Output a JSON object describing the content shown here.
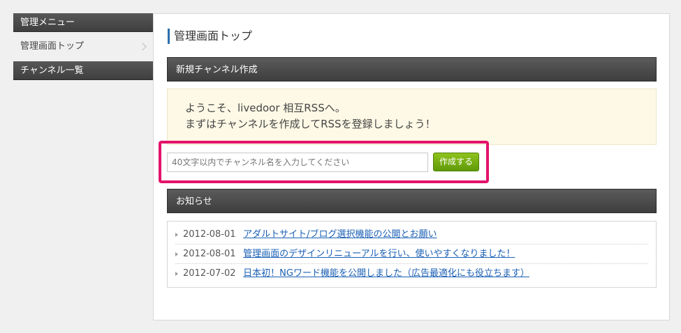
{
  "sidebar": {
    "menu_heading": "管理メニュー",
    "menu_item": "管理画面トップ",
    "channels_heading": "チャンネル一覧"
  },
  "main": {
    "title": "管理画面トップ",
    "new_channel": {
      "heading": "新規チャンネル作成",
      "welcome_line1": "ようこそ、livedoor 相互RSSへ。",
      "welcome_line2": "まずはチャンネルを作成してRSSを登録しましょう！",
      "input_placeholder": "40文字以内でチャンネル名を入力してください",
      "input_value": "",
      "submit_label": "作成する"
    },
    "news": {
      "heading": "お知らせ",
      "items": [
        {
          "date": "2012-08-01",
          "text": "アダルトサイト/ブログ選択機能の公開とお願い"
        },
        {
          "date": "2012-08-01",
          "text": "管理画面のデザインリニューアルを行い、使いやすくなりました！"
        },
        {
          "date": "2012-07-02",
          "text": "日本初！NGワード機能を公開しました（広告最適化にも役立ちます）"
        }
      ]
    }
  },
  "colors": {
    "highlight": "#e3136a",
    "button": "#7cb312",
    "link": "#1a5fb4",
    "title_accent": "#2a6fb0"
  },
  "icons": {
    "chevron": "chevron-right-icon",
    "bullet": "triangle-bullet-icon"
  }
}
